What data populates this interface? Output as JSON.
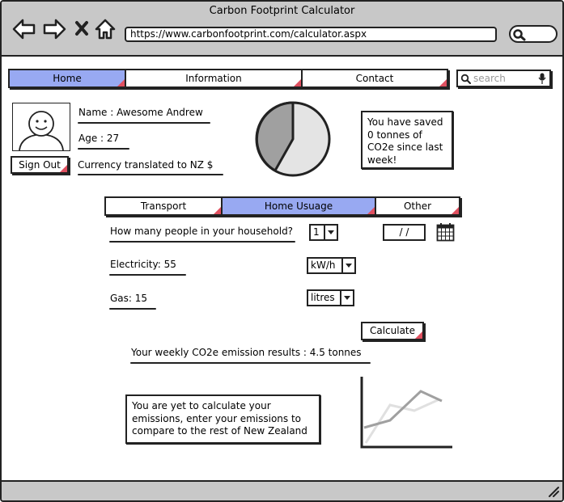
{
  "window": {
    "title": "Carbon Footprint Calculator"
  },
  "browser": {
    "url": "https://www.carbonfootprint.com/calculator.aspx",
    "icons": [
      "back-icon",
      "forward-icon",
      "close-icon",
      "home-icon",
      "search-icon"
    ]
  },
  "nav": {
    "tabs": [
      {
        "label": "Home",
        "active": true
      },
      {
        "label": "Information",
        "active": false
      },
      {
        "label": "Contact",
        "active": false
      }
    ],
    "search_placeholder": "search"
  },
  "profile": {
    "name": "Name : Awesome Andrew",
    "age": "Age : 27",
    "currency": "Currency translated to NZ $",
    "sign_out": "Sign Out"
  },
  "savings_note": {
    "lines": [
      "You have saved",
      "0 tonnes of",
      "CO2e since last",
      "week!"
    ]
  },
  "usage_tabs": [
    {
      "label": "Transport",
      "active": false
    },
    {
      "label": "Home Usuage",
      "active": true
    },
    {
      "label": "Other",
      "active": false
    }
  ],
  "form": {
    "household_question": "How many people in your household?",
    "household_value": "1",
    "date_value": "/ /",
    "electricity": "Electricity: 55",
    "electricity_unit": "kW/h",
    "gas": "Gas: 15",
    "gas_unit": "litres",
    "calculate": "Calculate"
  },
  "results": {
    "weekly": "Your weekly CO2e emission results : 4.5 tonnes",
    "message_lines": [
      "You are yet to calculate your",
      "emissions, enter your emissions to",
      "compare to the rest of New Zealand"
    ]
  },
  "colors": {
    "active_tab": "#98a9f2",
    "chrome": "#c8c8c8",
    "corner_mark": "#e05060",
    "pie_dark": "#a0a0a0",
    "pie_light": "#e4e4e4"
  }
}
